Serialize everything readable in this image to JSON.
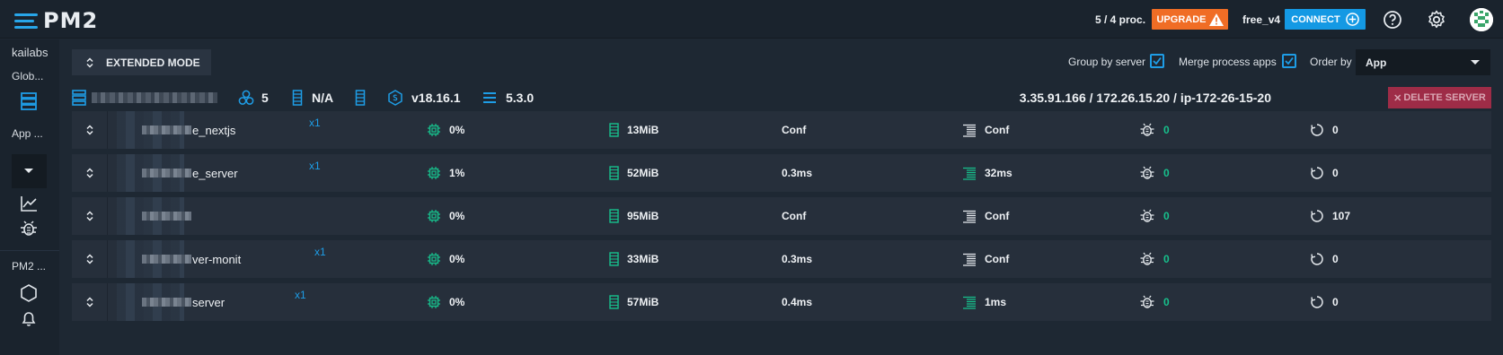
{
  "app": {
    "logo_text": "PM2"
  },
  "topbar": {
    "proc_count": "5 / 4 proc.",
    "upgrade_label": "UPGRADE",
    "plan": "free_v4",
    "connect_label": "CONNECT"
  },
  "sidebar": {
    "org": "kailabs",
    "global_label": "Glob...",
    "app_label": "App ...",
    "pm2_label": "PM2 ..."
  },
  "toolbar": {
    "extended_mode_label": "EXTENDED MODE",
    "group_by_server_label": "Group by server",
    "group_by_server_checked": true,
    "merge_process_label": "Merge process apps",
    "merge_process_checked": true,
    "order_by_label": "Order by",
    "order_by_value": "App"
  },
  "server": {
    "process_count": "5",
    "memory": "N/A",
    "node_version": "v18.16.1",
    "pm2_version": "5.3.0",
    "address": "3.35.91.166 / 172.26.15.20 / ip-172-26-15-20",
    "delete_label": "DELETE SERVER"
  },
  "processes": [
    {
      "name": "e_nextjs",
      "instances": "x1",
      "cpu": "0%",
      "memory": "13MiB",
      "latency": "Conf",
      "http": "Conf",
      "issues": "0",
      "restarts": "0"
    },
    {
      "name": "e_server",
      "instances": "x1",
      "cpu": "1%",
      "memory": "52MiB",
      "latency": "0.3ms",
      "http": "32ms",
      "issues": "0",
      "restarts": "0"
    },
    {
      "name": "",
      "instances": "",
      "cpu": "0%",
      "memory": "95MiB",
      "latency": "Conf",
      "http": "Conf",
      "issues": "0",
      "restarts": "107"
    },
    {
      "name": "ver-monit",
      "instances": "x1",
      "cpu": "0%",
      "memory": "33MiB",
      "latency": "0.3ms",
      "http": "Conf",
      "issues": "0",
      "restarts": "0"
    },
    {
      "name": "server",
      "instances": "x1",
      "cpu": "0%",
      "memory": "57MiB",
      "latency": "0.4ms",
      "http": "1ms",
      "issues": "0",
      "restarts": "0"
    }
  ],
  "colors": {
    "accent": "#1e9de6",
    "green": "#17c08c",
    "upgrade": "#f06d25",
    "delete": "#9e2c47",
    "background": "#1e2833"
  }
}
